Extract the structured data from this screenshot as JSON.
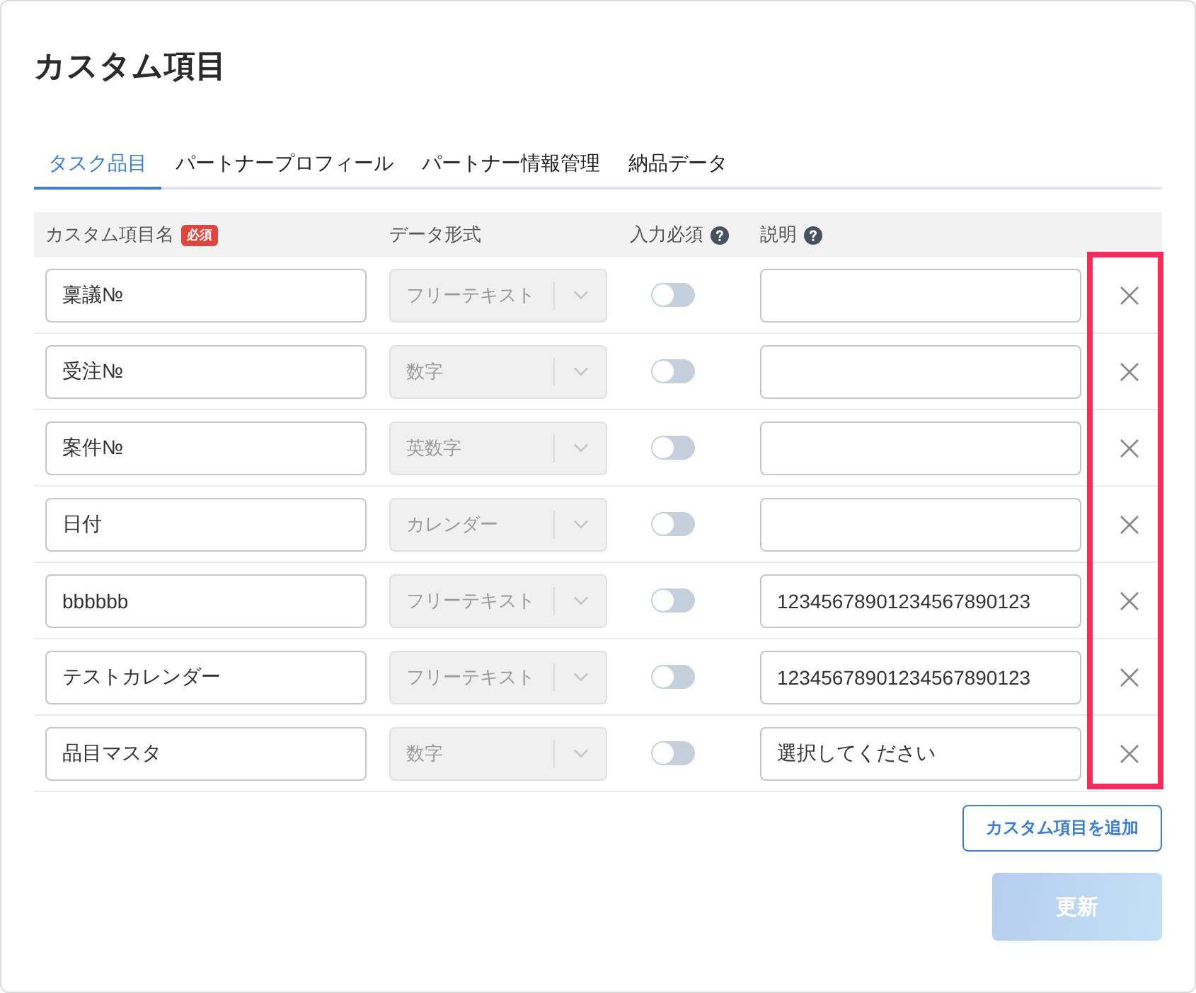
{
  "dialog": {
    "title": "カスタム項目"
  },
  "tabs": [
    {
      "label": "タスク品目",
      "selected": true
    },
    {
      "label": "パートナープロフィール",
      "selected": false
    },
    {
      "label": "パートナー情報管理",
      "selected": false
    },
    {
      "label": "納品データ",
      "selected": false
    }
  ],
  "table": {
    "columns": [
      {
        "label": "カスタム項目名",
        "badge": "必須",
        "help": false
      },
      {
        "label": "データ形式",
        "help": false
      },
      {
        "label": "入力必須",
        "help": true
      },
      {
        "label": "説明",
        "help": true
      }
    ],
    "rows": [
      {
        "name": "稟議№",
        "data_type": {
          "value": "フリーテキスト",
          "disabled": true
        },
        "required_toggle": {
          "on": false
        }
      },
      {
        "name": "受注№",
        "data_type": {
          "value": "数字",
          "disabled": true
        },
        "required_toggle": {
          "on": false
        }
      },
      {
        "name": "案件№",
        "data_type": {
          "value": "英数字",
          "disabled": true
        },
        "required_toggle": {
          "on": false
        }
      },
      {
        "name": "日付",
        "data_type": {
          "value": "カレンダー",
          "disabled": true
        },
        "required_toggle": {
          "on": false
        }
      },
      {
        "name": "bbbbbb",
        "data_type": {
          "value": "フリーテキスト",
          "disabled": true
        },
        "required_toggle": {
          "on": false
        },
        "description": "12345678901234567890123"
      },
      {
        "name": "テストカレンダー",
        "data_type": {
          "value": "フリーテキスト",
          "disabled": true
        },
        "required_toggle": {
          "on": false
        },
        "description": "12345678901234567890123"
      },
      {
        "name": "品目マスタ",
        "data_type": {
          "value": "数字",
          "disabled": true
        },
        "required_toggle": {
          "on": false
        },
        "description": "選択してください"
      }
    ]
  },
  "add_button": {
    "label": "カスタム項目を追加"
  },
  "submit_button": {
    "label": "更新",
    "disabled": true
  }
}
